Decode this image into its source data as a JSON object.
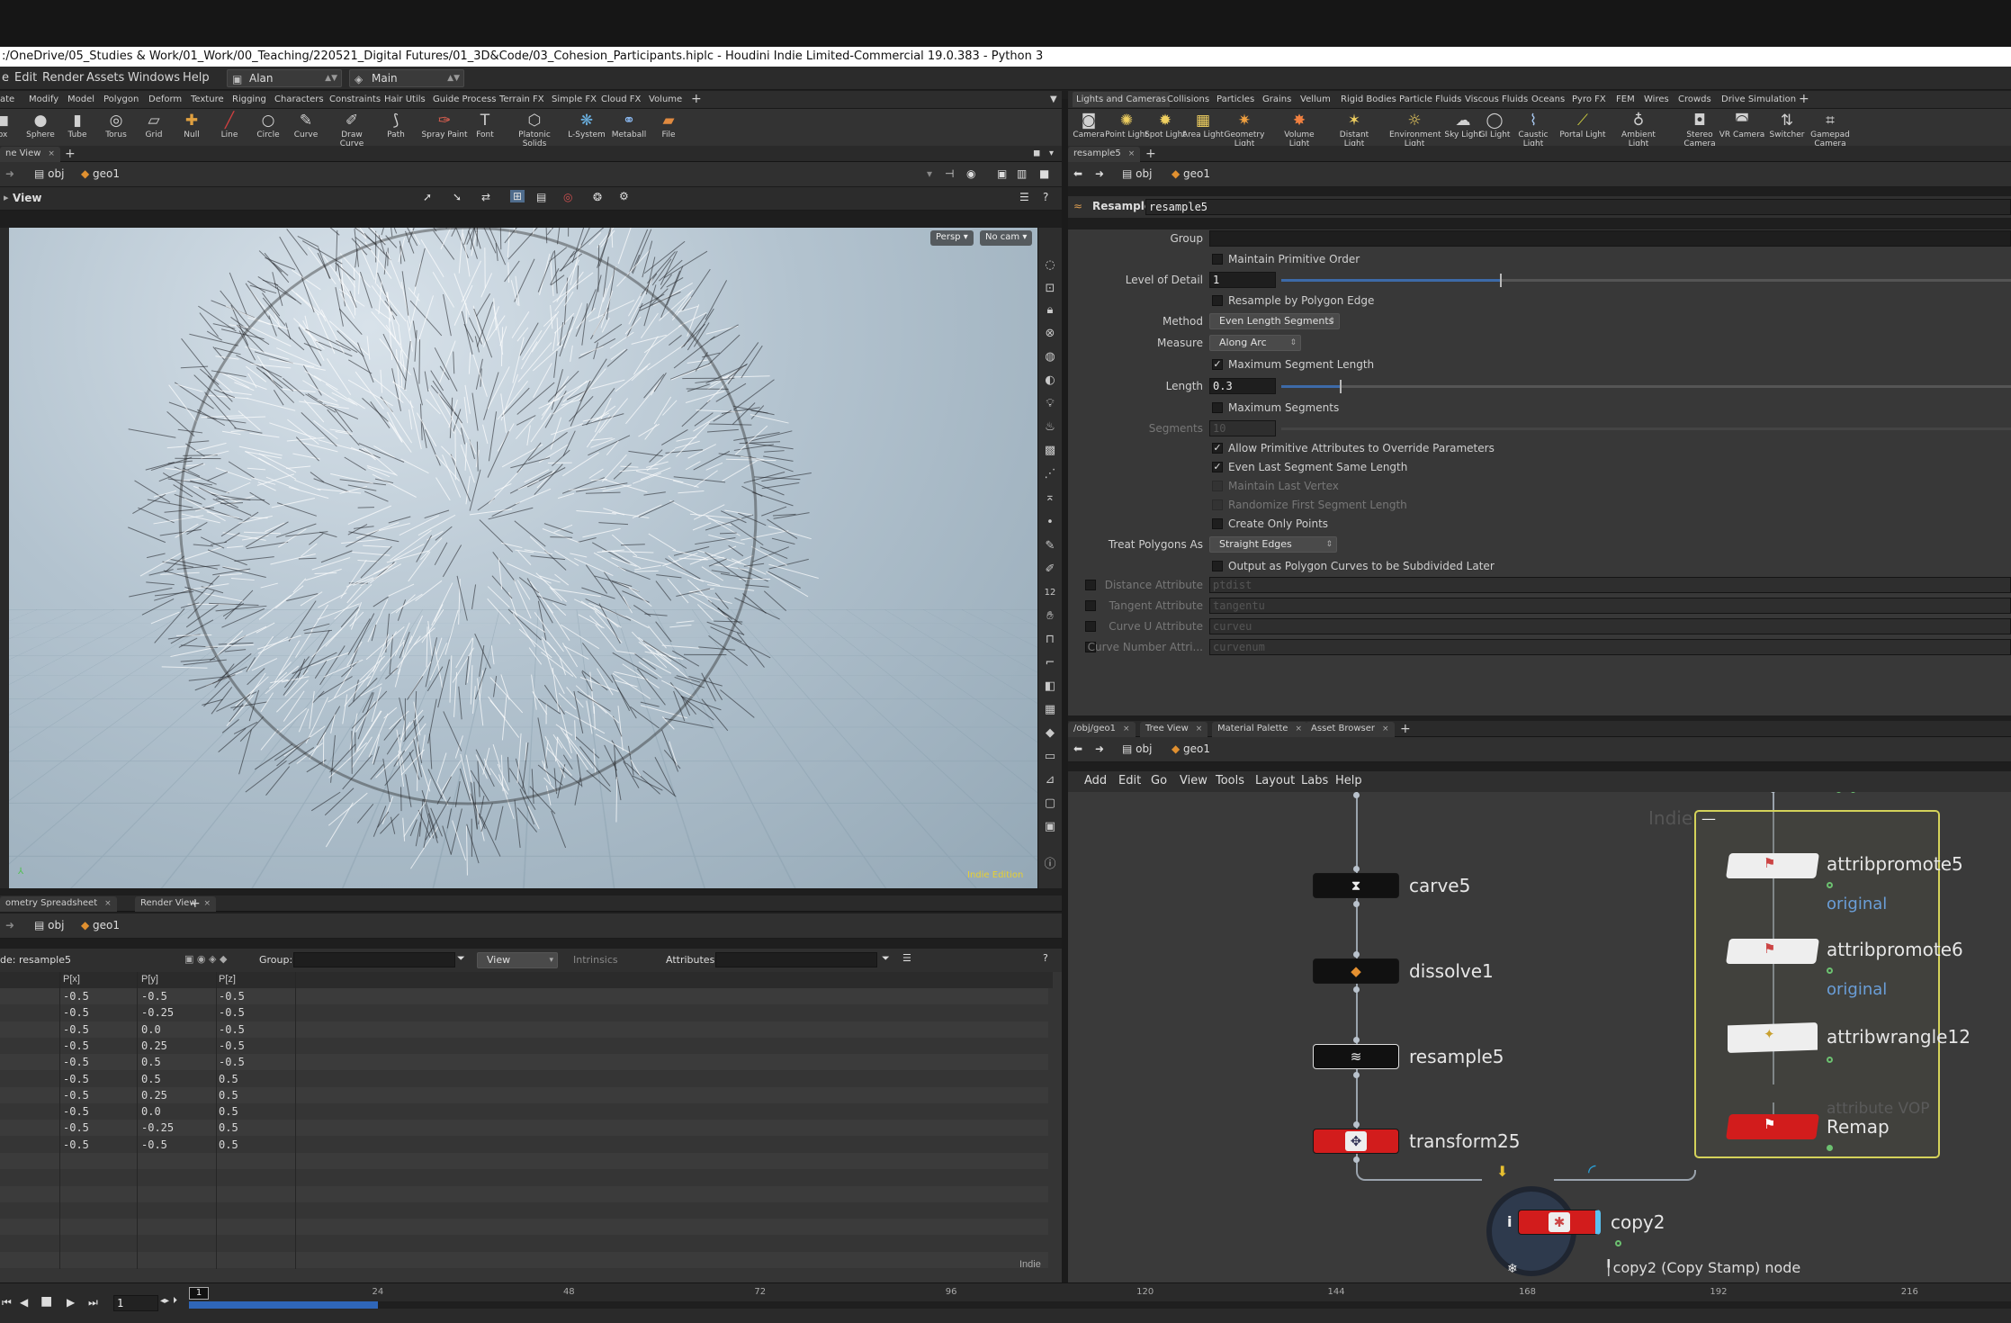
{
  "window": {
    "title": ":/OneDrive/05_Studies & Work/01_Work/00_Teaching/220521_Digital Futures/01_3D&Code/03_Cohesion_Participants.hiplc - Houdini Indie Limited-Commercial 19.0.383 - Python 3"
  },
  "menubar": {
    "items": [
      "e",
      "Edit",
      "Render",
      "Assets",
      "Windows",
      "Help"
    ],
    "desktop": "Alan",
    "context": "Main"
  },
  "shelf_left": {
    "tabs": [
      "ate",
      "Modify",
      "Model",
      "Polygon",
      "Deform",
      "Texture",
      "Rigging",
      "Characters",
      "Constraints",
      "Hair Utils",
      "Guide Process",
      "Terrain FX",
      "Simple FX",
      "Cloud FX",
      "Volume"
    ],
    "tools": [
      "ox",
      "Sphere",
      "Tube",
      "Torus",
      "Grid",
      "Null",
      "Line",
      "Circle",
      "Curve",
      "Draw Curve",
      "Path",
      "Spray Paint",
      "Font",
      "Platonic Solids",
      "L-System",
      "Metaball",
      "File"
    ]
  },
  "shelf_right": {
    "tabs": [
      "Lights and Cameras",
      "Collisions",
      "Particles",
      "Grains",
      "Vellum",
      "Rigid Bodies",
      "Particle Fluids",
      "Viscous Fluids",
      "Oceans",
      "Pyro FX",
      "FEM",
      "Wires",
      "Crowds",
      "Drive Simulation"
    ],
    "tools": [
      "Camera",
      "Point Light",
      "Spot Light",
      "Area Light",
      "Geometry Light",
      "Volume Light",
      "Distant Light",
      "Environment Light",
      "Sky Light",
      "GI Light",
      "Caustic Light",
      "Portal Light",
      "Ambient Light",
      "Stereo Camera",
      "VR Camera",
      "Switcher",
      "Gamepad Camera"
    ]
  },
  "scene_view": {
    "tab": "ne View",
    "path_obj": "obj",
    "path_geo": "geo1",
    "header": "View",
    "persp": "Persp",
    "cam": "No cam",
    "watermark": "Indie Edition"
  },
  "params": {
    "tab": "resample5",
    "path_obj": "obj",
    "path_geo": "geo1",
    "node_type": "Resample",
    "node_name": "resample5",
    "group_label": "Group",
    "maintain_order": "Maintain Primitive Order",
    "lod_label": "Level of Detail",
    "lod_value": "1",
    "lod_slider": 0.3,
    "resample_edge": "Resample by Polygon Edge",
    "method_label": "Method",
    "method_value": "Even Length Segments",
    "measure_label": "Measure",
    "measure_value": "Along Arc",
    "max_seg_len": "Maximum Segment Length",
    "max_seg_len_checked": true,
    "length_label": "Length",
    "length_value": "0.3",
    "length_slider": 0.08,
    "max_segs": "Maximum Segments",
    "segments_label": "Segments",
    "segments_value": "10",
    "allow_prim": "Allow Primitive Attributes to Override Parameters",
    "even_last": "Even Last Segment Same Length",
    "maintain_last": "Maintain Last Vertex",
    "randomize_first": "Randomize First Segment Length",
    "create_points": "Create Only Points",
    "treat_label": "Treat Polygons As",
    "treat_value": "Straight Edges",
    "output_curves": "Output as Polygon Curves to be Subdivided Later",
    "dist_attr_label": "Distance Attribute",
    "dist_attr_value": "ptdist",
    "tan_attr_label": "Tangent Attribute",
    "tan_attr_value": "tangentu",
    "curveu_label": "Curve U Attribute",
    "curveu_value": "curveu",
    "curvenum_label": "Curve Number Attri...",
    "curvenum_value": "curvenum"
  },
  "spreadsheet": {
    "tabs": [
      "ometry Spreadsheet",
      "Render View"
    ],
    "path_obj": "obj",
    "path_geo": "geo1",
    "node_label": "de: resample5",
    "group_label": "Group:",
    "view_label": "View",
    "intrinsics": "Intrinsics",
    "attributes": "Attributes:",
    "columns": [
      "P[x]",
      "P[y]",
      "P[z]"
    ],
    "rows": [
      [
        "-0.5",
        "-0.5",
        "-0.5"
      ],
      [
        "-0.5",
        "-0.25",
        "-0.5"
      ],
      [
        "-0.5",
        "0.0",
        "-0.5"
      ],
      [
        "-0.5",
        "0.25",
        "-0.5"
      ],
      [
        "-0.5",
        "0.5",
        "-0.5"
      ],
      [
        "-0.5",
        "0.5",
        "0.5"
      ],
      [
        "-0.5",
        "0.25",
        "0.5"
      ],
      [
        "-0.5",
        "0.0",
        "0.5"
      ],
      [
        "-0.5",
        "-0.25",
        "0.5"
      ],
      [
        "-0.5",
        "-0.5",
        "0.5"
      ]
    ],
    "footer": "Indie"
  },
  "network": {
    "tabs": [
      "/obj/geo1",
      "Tree View",
      "Material Palette",
      "Asset Browser"
    ],
    "path_obj": "obj",
    "path_geo": "geo1",
    "menu": [
      "Add",
      "Edit",
      "Go",
      "View",
      "Tools",
      "Layout",
      "Labs",
      "Help"
    ],
    "watermark": "Indie",
    "nodes": {
      "carve": "carve5",
      "dissolve": "dissolve1",
      "resample": "resample5",
      "transform": "transform25",
      "copy": "copy2",
      "copy_tip": "copy2 (Copy Stamp) node",
      "promote5": "attribpromote5",
      "promote5_sub": "original",
      "promote6": "attribpromote6",
      "promote6_sub": "original",
      "wrangle": "attribwrangle12",
      "ghost": "attribute VOP",
      "remap": "Remap"
    }
  },
  "timeline": {
    "frame": "1",
    "frame_field": "1",
    "ticks": [
      "24",
      "48",
      "72",
      "96",
      "120",
      "144",
      "168",
      "192",
      "216"
    ]
  }
}
